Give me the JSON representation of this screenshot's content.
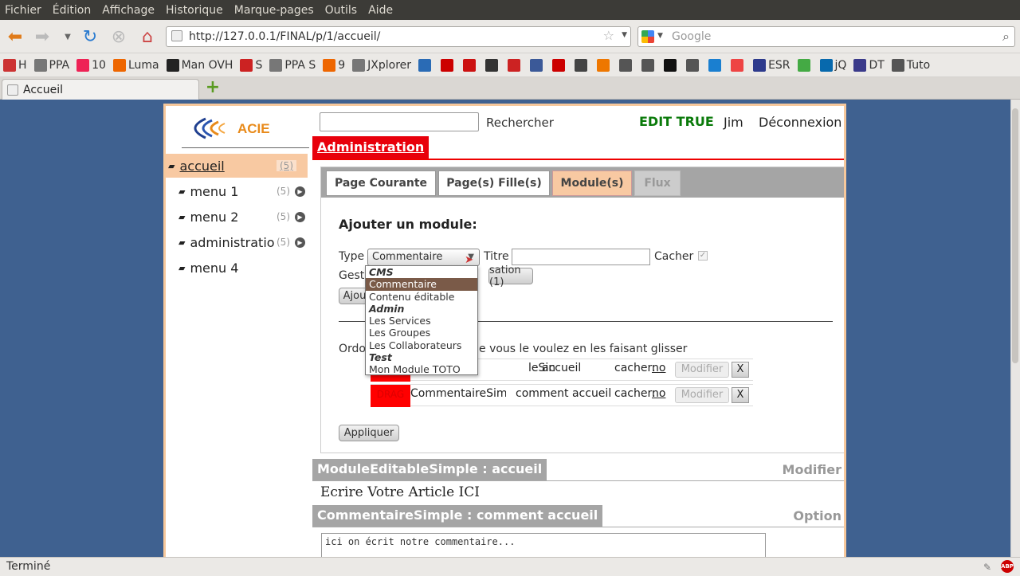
{
  "menubar": {
    "items": [
      "Fichier",
      "Édition",
      "Affichage",
      "Historique",
      "Marque-pages",
      "Outils",
      "Aide"
    ]
  },
  "nav": {
    "url": "http://127.0.0.1/FINAL/p/1/accueil/",
    "search_placeholder": "Google"
  },
  "bookmarks": [
    {
      "label": "H",
      "icon": "zh-icon",
      "color": "#c33"
    },
    {
      "label": "PPA",
      "icon": "heart-icon",
      "color": "#777"
    },
    {
      "label": "10",
      "icon": "ubuntu-icon",
      "color": "#e25"
    },
    {
      "label": "Luma",
      "icon": "ubuntu-icon",
      "color": "#e60"
    },
    {
      "label": "Man OVH",
      "icon": "ovh-icon",
      "color": "#222"
    },
    {
      "label": "S",
      "icon": "s-icon",
      "color": "#c22"
    },
    {
      "label": "PPA S",
      "icon": "heart-icon",
      "color": "#777"
    },
    {
      "label": "9",
      "icon": "ubuntu-icon",
      "color": "#e60"
    },
    {
      "label": "JXplorer",
      "icon": "jx-icon",
      "color": "#777"
    },
    {
      "label": "",
      "icon": "sb-icon",
      "color": "#2a6bb5"
    },
    {
      "label": "",
      "icon": "free-icon",
      "color": "#c00"
    },
    {
      "label": "",
      "icon": "box-icon",
      "color": "#c11"
    },
    {
      "label": "",
      "icon": "hp-icon",
      "color": "#333"
    },
    {
      "label": "",
      "icon": "gmail-icon",
      "color": "#c22"
    },
    {
      "label": "",
      "icon": "facebook-icon",
      "color": "#3b5998"
    },
    {
      "label": "",
      "icon": "youtube-icon",
      "color": "#c00"
    },
    {
      "label": "",
      "icon": "me-icon",
      "color": "#444"
    },
    {
      "label": "",
      "icon": "jpa-icon",
      "color": "#e70"
    },
    {
      "label": "",
      "icon": "cow-icon",
      "color": "#555"
    },
    {
      "label": "",
      "icon": "square-icon",
      "color": "#555"
    },
    {
      "label": "",
      "icon": "li-icon",
      "color": "#111"
    },
    {
      "label": "",
      "icon": "oc-icon",
      "color": "#555"
    },
    {
      "label": "",
      "icon": "drop-icon",
      "color": "#1a7fd0"
    },
    {
      "label": "",
      "icon": "asterisk-icon",
      "color": "#e44"
    },
    {
      "label": "ESR",
      "icon": "esr-icon",
      "color": "#2d3a8c"
    },
    {
      "label": "",
      "icon": "w3c-icon",
      "color": "#4a4"
    },
    {
      "label": "jQ",
      "icon": "jq-icon",
      "color": "#0769ad"
    },
    {
      "label": "DT",
      "icon": "dt-icon",
      "color": "#3a3a8a"
    },
    {
      "label": "Tuto",
      "icon": "tuto-icon",
      "color": "#555"
    }
  ],
  "tab": {
    "title": "Accueil"
  },
  "sidebar": {
    "items": [
      {
        "label": "accueil",
        "count": "(5)"
      },
      {
        "label": "menu 1",
        "count": "(5)"
      },
      {
        "label": "menu 2",
        "count": "(5)"
      },
      {
        "label": "administratio",
        "count": "(5)"
      },
      {
        "label": "menu 4",
        "count": ""
      }
    ]
  },
  "header": {
    "search_label": "Rechercher",
    "edit_flag": "EDIT TRUE",
    "user": "Jim",
    "logout": "Déconnexion"
  },
  "admin": {
    "title": "Administration"
  },
  "tabs": [
    "Page Courante",
    "Page(s) Fille(s)",
    "Module(s)",
    "Flux"
  ],
  "form": {
    "title": "Ajouter un module:",
    "type_label": "Type",
    "type_value": "Commentaire",
    "titre_label": "Titre",
    "cacher_label": "Cacher",
    "gestion_label": "Gestio",
    "gestion_btn": "sation (1)",
    "ajouter_btn": "Ajou",
    "order_text_left": "Ordon",
    "order_text_right": "e vous le voulez en les faisant glisser",
    "apply_btn": "Appliquer"
  },
  "rows": [
    {
      "drag": "",
      "name": "leSin",
      "title": "accueil",
      "cacher": "cacher:",
      "cacher_val": "no",
      "modify": "Modifier",
      "x": "X"
    },
    {
      "drag": "DRAG",
      "name": "CommentaireSimp",
      "title": "comment accueil",
      "cacher": "cacher:",
      "cacher_val": "no",
      "modify": "Modifier",
      "x": "X"
    }
  ],
  "dropdown": [
    {
      "label": "CMS",
      "group": true
    },
    {
      "label": "Commentaire",
      "selected": true
    },
    {
      "label": "Contenu éditable"
    },
    {
      "label": "Admin",
      "group": true
    },
    {
      "label": "Les Services"
    },
    {
      "label": "Les Groupes"
    },
    {
      "label": "Les Collaborateurs"
    },
    {
      "label": "Test",
      "group": true
    },
    {
      "label": "Mon Module TOTO"
    }
  ],
  "modules": [
    {
      "title": "ModuleEditableSimple : accueil",
      "action": "Modifier",
      "content": "Ecrire Votre Article ICI"
    },
    {
      "title": "CommentaireSimple : comment accueil",
      "action": "Option",
      "content": "ici on écrit notre commentaire..."
    }
  ],
  "status": {
    "text": "Terminé"
  },
  "colors": {
    "accent": "#e8000b",
    "sidebar_active": "#f8c9a2",
    "edit": "#0a7a0a"
  }
}
